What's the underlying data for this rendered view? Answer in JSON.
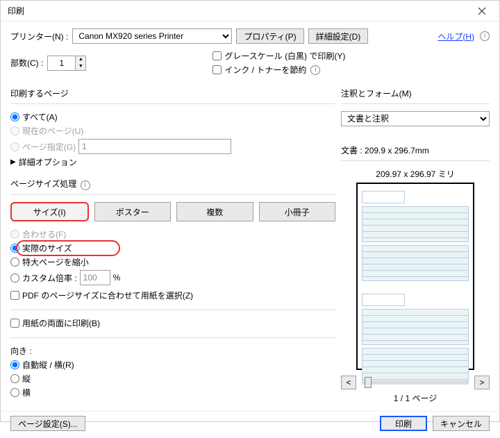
{
  "title": "印刷",
  "printer_label": "プリンター(N) :",
  "printer_selected": "Canon MX920 series Printer",
  "properties_btn": "プロパティ(P)",
  "advanced_btn": "詳細設定(D)",
  "help_link": "ヘルプ(H)",
  "copies_label": "部数(C) :",
  "copies_value": "1",
  "grayscale_label": "グレースケール (白黒) で印刷(Y)",
  "savetoner_label": "インク / トナーを節約",
  "pages_group": "印刷するページ",
  "pages_all": "すべて(A)",
  "pages_current": "現在のページ(U)",
  "pages_range": "ページ指定(G)",
  "pages_range_value": "1",
  "advanced_options": "詳細オプション",
  "size_handling": "ページサイズ処理",
  "tab_size": "サイズ(I)",
  "tab_poster": "ポスター",
  "tab_multi": "複数",
  "tab_booklet": "小冊子",
  "fit_label": "合わせる(F)",
  "actual_label": "実際のサイズ",
  "shrink_label": "特大ページを縮小",
  "custom_label": "カスタム倍率 :",
  "custom_value": "100",
  "custom_unit": "%",
  "pdf_match_label": "PDF のページサイズに合わせて用紙を選択(Z)",
  "duplex_label": "用紙の両面に印刷(B)",
  "orient_label": "向き :",
  "orient_auto": "自動縦 / 横(R)",
  "orient_portrait": "縦",
  "orient_landscape": "横",
  "comments_label": "注釈とフォーム(M)",
  "comments_selected": "文書と注釈",
  "doc_label": "文書 :",
  "doc_size": "209.9 x 296.7mm",
  "preview_size": "209.97 x 296.97 ミリ",
  "page_indicator": "1 / 1 ページ",
  "page_setup_btn": "ページ設定(S)...",
  "print_btn": "印刷",
  "cancel_btn": "キャンセル"
}
